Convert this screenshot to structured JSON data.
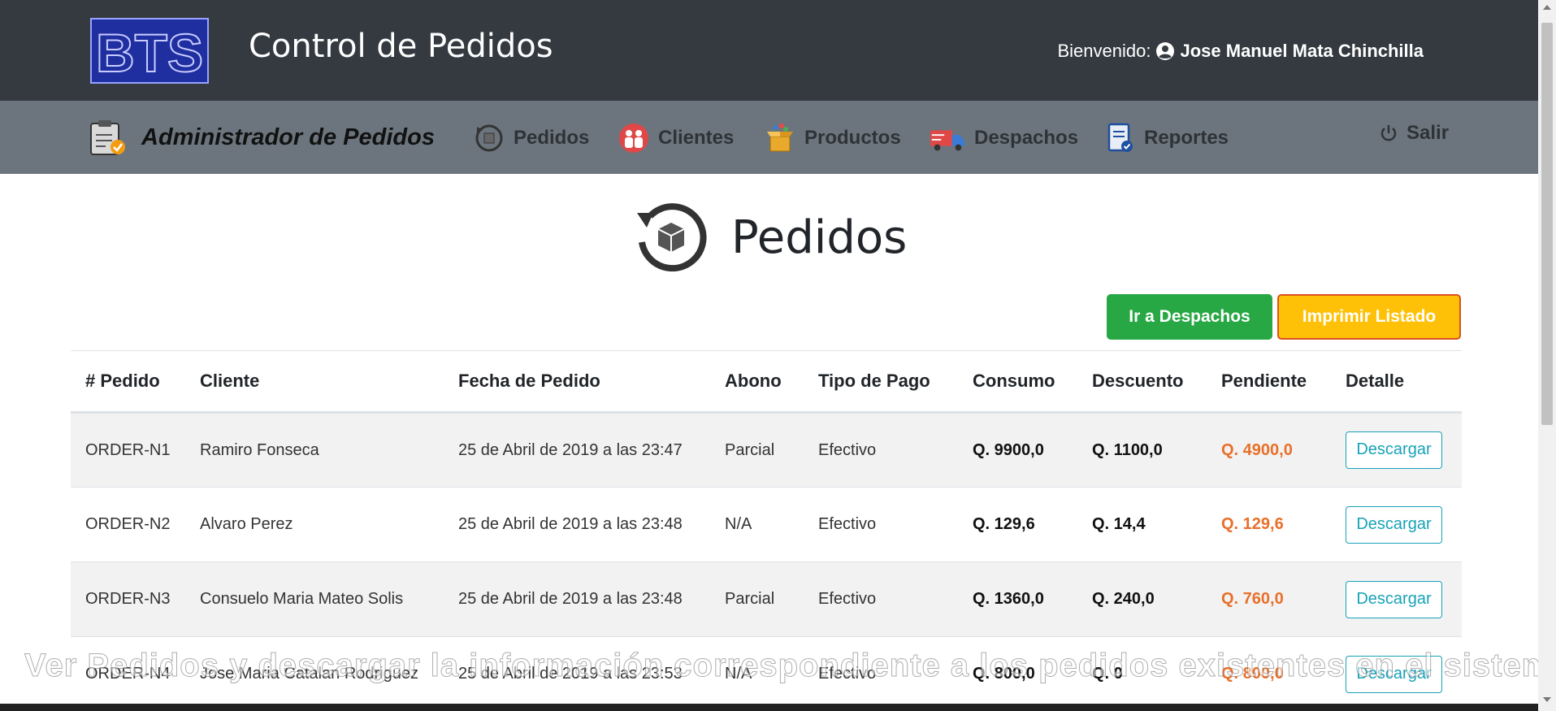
{
  "header": {
    "logo_text": "BTS",
    "title": "Control de Pedidos",
    "welcome_label": "Bienvenido:",
    "user_name": "Jose Manuel Mata Chinchilla"
  },
  "nav": {
    "brand": "Administrador de Pedidos",
    "items": [
      {
        "label": "Pedidos",
        "icon": "order-refresh-icon"
      },
      {
        "label": "Clientes",
        "icon": "clients-icon"
      },
      {
        "label": "Productos",
        "icon": "products-box-icon"
      },
      {
        "label": "Despachos",
        "icon": "truck-icon"
      },
      {
        "label": "Reportes",
        "icon": "report-icon"
      }
    ],
    "logout": "Salir"
  },
  "page": {
    "title": "Pedidos",
    "btn_dispatch": "Ir a Despachos",
    "btn_print": "Imprimir Listado"
  },
  "table": {
    "headers": [
      "# Pedido",
      "Cliente",
      "Fecha de Pedido",
      "Abono",
      "Tipo de Pago",
      "Consumo",
      "Descuento",
      "Pendiente",
      "Detalle"
    ],
    "rows": [
      {
        "id": "ORDER-N1",
        "client": "Ramiro Fonseca",
        "date": "25 de Abril de 2019 a las 23:47",
        "abono": "Parcial",
        "pago": "Efectivo",
        "consumo": "Q. 9900,0",
        "descuento": "Q. 1100,0",
        "pendiente": "Q. 4900,0",
        "detalle": "Descargar"
      },
      {
        "id": "ORDER-N2",
        "client": "Alvaro Perez",
        "date": "25 de Abril de 2019 a las 23:48",
        "abono": "N/A",
        "pago": "Efectivo",
        "consumo": "Q. 129,6",
        "descuento": "Q. 14,4",
        "pendiente": "Q. 129,6",
        "detalle": "Descargar"
      },
      {
        "id": "ORDER-N3",
        "client": "Consuelo Maria Mateo Solis",
        "date": "25 de Abril de 2019 a las 23:48",
        "abono": "Parcial",
        "pago": "Efectivo",
        "consumo": "Q. 1360,0",
        "descuento": "Q. 240,0",
        "pendiente": "Q. 760,0",
        "detalle": "Descargar"
      },
      {
        "id": "ORDER-N4",
        "client": "Jose Maria Catalan Rodriguez",
        "date": "25 de Abril de 2019 a las 23:53",
        "abono": "N/A",
        "pago": "Efectivo",
        "consumo": "Q. 800,0",
        "descuento": "Q. 0",
        "pendiente": "Q. 800,0",
        "detalle": "Descargar"
      }
    ]
  },
  "caption": "Ver Pedidos y descargar la información correspondiente a los pedidos existentes en el sistema.",
  "colors": {
    "header_bg": "#343a40",
    "nav_bg": "#6c757d",
    "green": "#28a745",
    "yellow": "#ffc107",
    "pending": "#e8702a",
    "info": "#17a2b8"
  }
}
